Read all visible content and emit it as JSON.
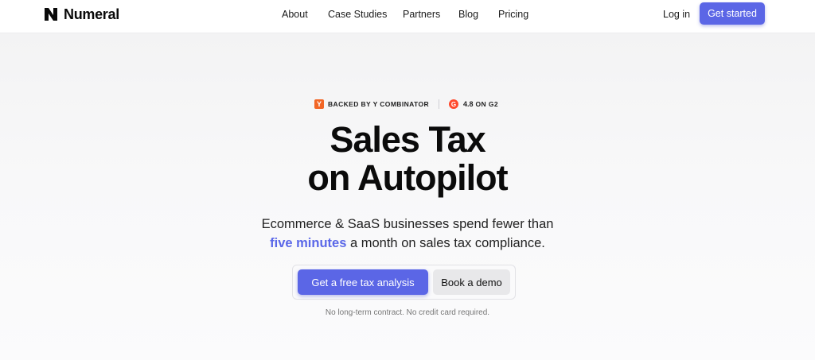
{
  "nav": {
    "logo_text": "Numeral",
    "links": [
      "About",
      "Case Studies",
      "Partners",
      "Blog",
      "Pricing"
    ],
    "login": "Log in",
    "get_started": "Get started"
  },
  "badges": {
    "yc_icon": "Y",
    "yc_text": "BACKED BY Y COMBINATOR",
    "g2_icon": "G",
    "rating": "4.8",
    "rating_suffix": "ON G2"
  },
  "hero": {
    "headline_line1": "Sales Tax",
    "headline_line2": "on Autopilot",
    "sub_line1": "Ecommerce & SaaS businesses spend fewer than",
    "sub_highlight": "five minutes",
    "sub_line2_rest": " a month on sales tax compliance.",
    "cta_primary": "Get a free tax analysis",
    "cta_secondary": "Book a demo",
    "footnote": "No long-term contract. No credit card required."
  },
  "colors": {
    "accent": "#5b66e6",
    "highlight": "#5a67e8",
    "yc_orange": "#f26625",
    "g2_red": "#ff492c"
  }
}
